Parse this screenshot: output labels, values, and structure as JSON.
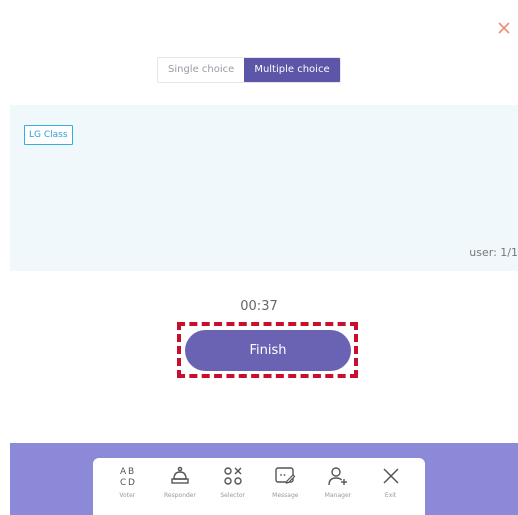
{
  "header": {
    "close_icon": "close-icon"
  },
  "mode_toggle": {
    "options": [
      "Single choice",
      "Multiple choice"
    ],
    "selected": "Multiple choice"
  },
  "panel": {
    "class_label": "LG Class",
    "user_count": "user: 1/1"
  },
  "timer": "00:37",
  "finish_label": "Finish",
  "toolbar": {
    "items": [
      {
        "label": "Voter",
        "icon": "abcd-icon"
      },
      {
        "label": "Responder",
        "icon": "bell-icon"
      },
      {
        "label": "Selector",
        "icon": "circles-x-icon"
      },
      {
        "label": "Message",
        "icon": "message-icon"
      },
      {
        "label": "Manager",
        "icon": "add-user-icon"
      },
      {
        "label": "Exit",
        "icon": "close-icon"
      }
    ]
  },
  "colors": {
    "accent": "#5b56a7",
    "finish_button": "#6a63b4",
    "bottom_bar": "#8c8ad8",
    "panel_bg": "#f0f8fc",
    "badge": "#35aee0",
    "close": "#f08a78",
    "annotation": "#c8102e"
  }
}
